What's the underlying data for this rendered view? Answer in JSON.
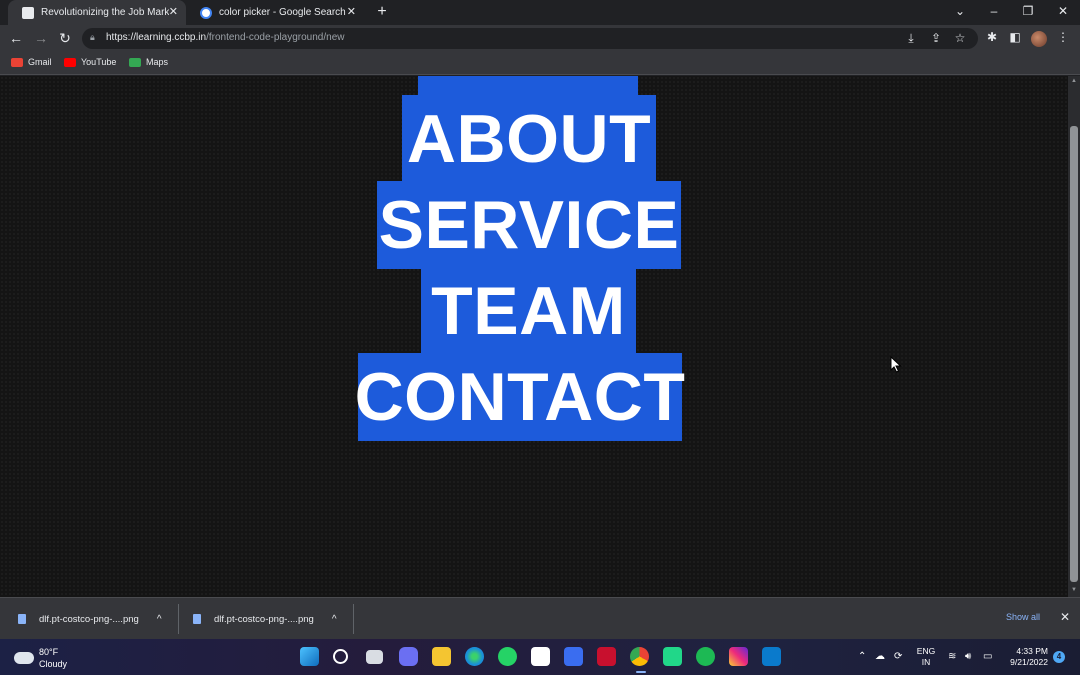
{
  "browser": {
    "tabs": [
      {
        "title": "Revolutionizing the Job Market |",
        "active": true
      },
      {
        "title": "color picker - Google Search",
        "active": false
      }
    ],
    "new_tab_icon": "plus-icon",
    "url_host": "https://learning.ccbp.in",
    "url_path": "/frontend-code-playground/new",
    "bookmarks": [
      "Gmail",
      "YouTube",
      "Maps"
    ]
  },
  "page": {
    "nav_items": [
      "ABOUT",
      "SERVICE",
      "TEAM",
      "CONTACT"
    ],
    "highlight_color": "#1d5bdb",
    "background_color": "#141414"
  },
  "downloads": {
    "items": [
      "dlf.pt-costco-png-....png",
      "dlf.pt-costco-png-....png"
    ],
    "show_all": "Show all"
  },
  "taskbar": {
    "weather_temp": "80°F",
    "weather_desc": "Cloudy",
    "lang_line1": "ENG",
    "lang_line2": "IN",
    "time": "4:33 PM",
    "date": "9/21/2022",
    "notifications": "4"
  }
}
